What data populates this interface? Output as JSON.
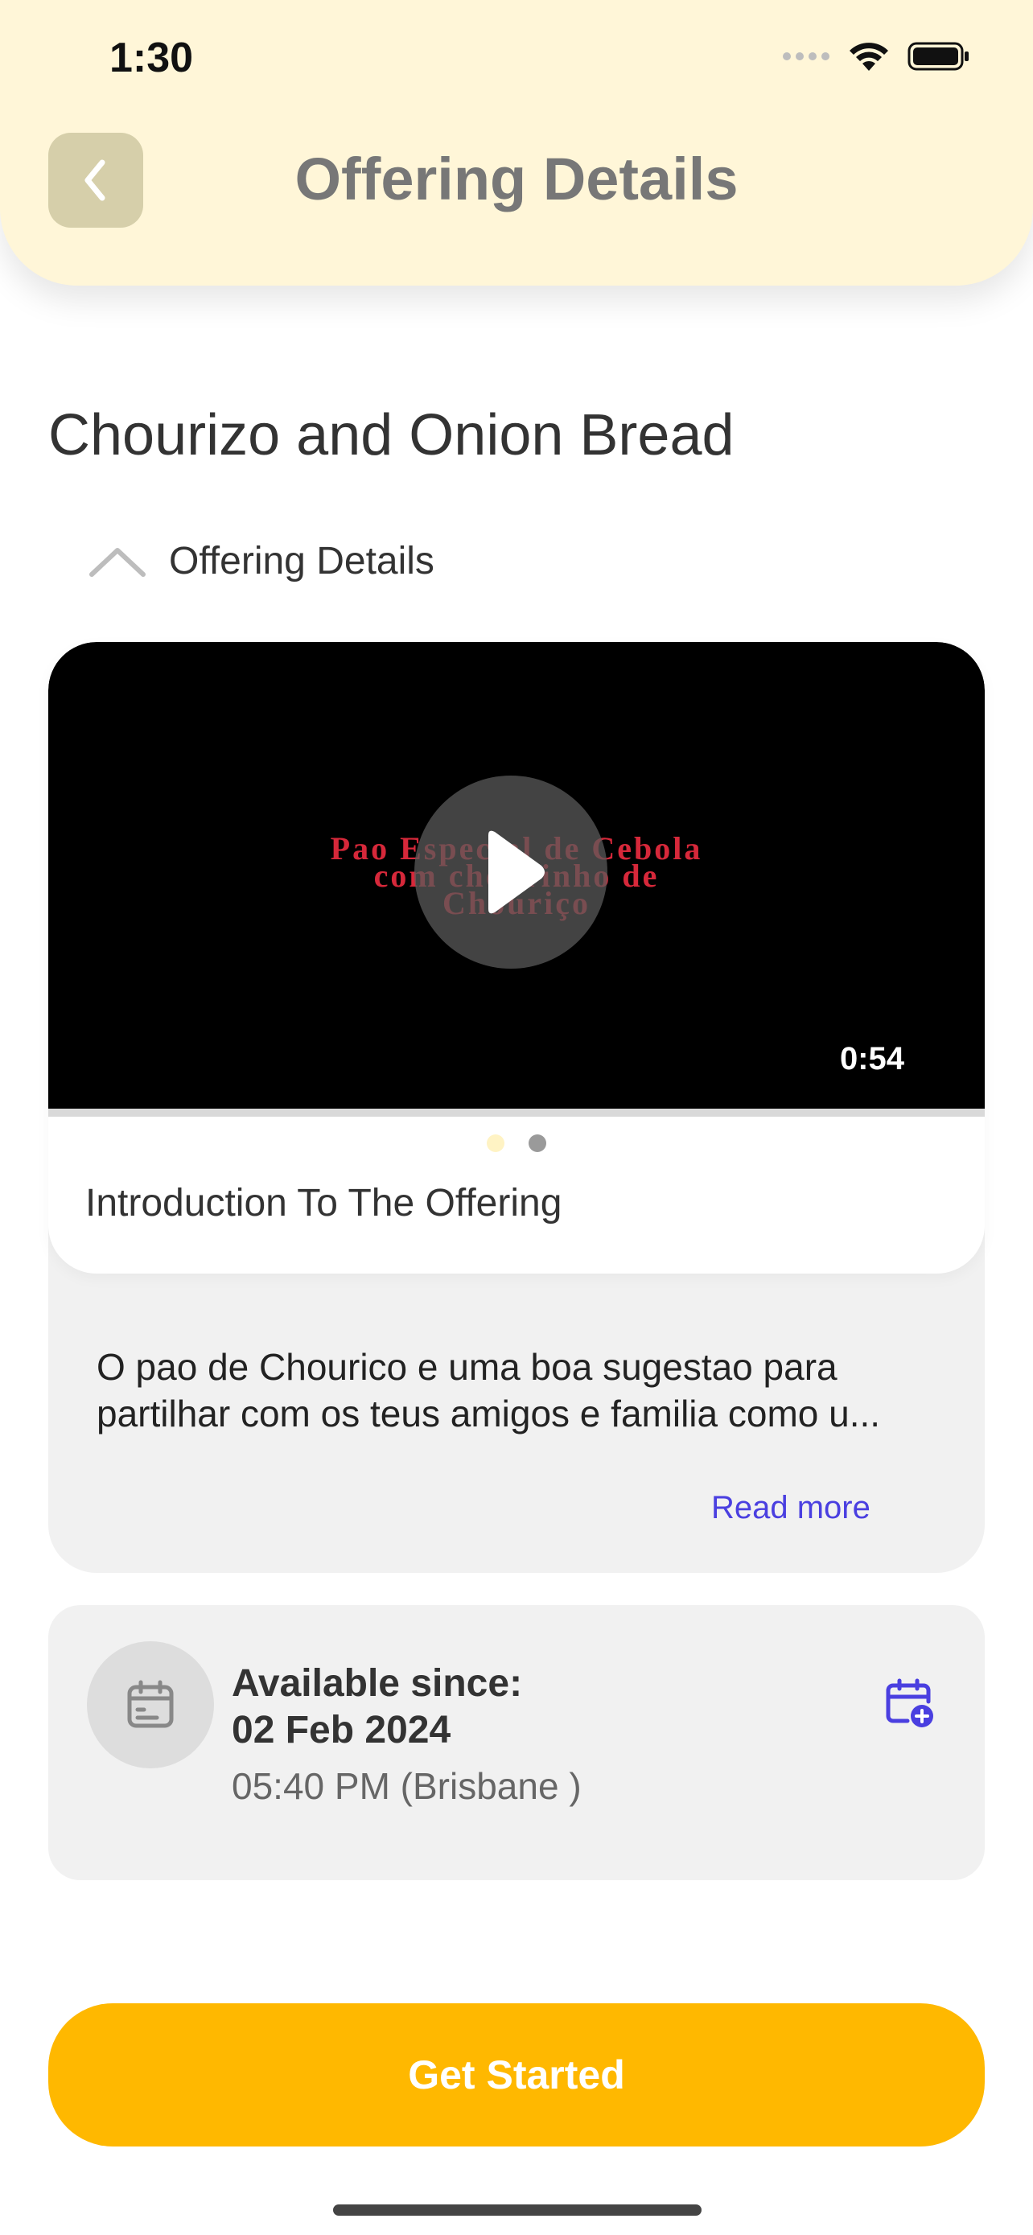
{
  "status_bar": {
    "time": "1:30"
  },
  "header": {
    "title": "Offering Details",
    "back_icon": "chevron-left-icon"
  },
  "offering": {
    "title": "Chourizo and Onion Bread"
  },
  "section": {
    "label": "Offering Details",
    "icon": "chevron-up-icon"
  },
  "media": {
    "caption_line1": "Pao Especial de Cebola",
    "caption_line2": "com chourinho de",
    "caption_line3": "Chouriço",
    "duration": "0:54",
    "label": "Introduction To The Offering",
    "page_count": 2,
    "current_page": 1
  },
  "description": {
    "text": "O pao de Chourico e uma boa sugestao para partilhar com os teus amigos e familia como u...",
    "read_more": "Read more"
  },
  "availability": {
    "label": "Available since:",
    "date": "02 Feb 2024",
    "time": "05:40 PM (Brisbane )"
  },
  "cta": {
    "label": "Get Started"
  },
  "colors": {
    "header_bg": "#fff6d8",
    "accent": "#ffb800",
    "link": "#4a3fe0",
    "panel_bg": "#f1f1f1"
  }
}
